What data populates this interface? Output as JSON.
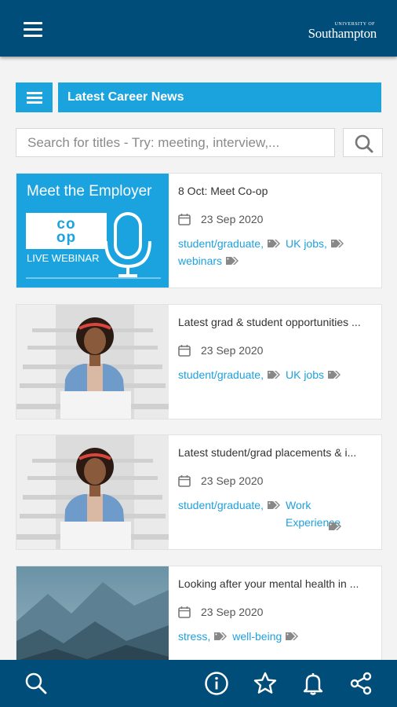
{
  "app": {
    "logo_small": "UNIVERSITY OF",
    "logo_main": "Southampton"
  },
  "section": {
    "title": "Latest Career News"
  },
  "search": {
    "placeholder": "Search for titles - Try: meeting, interview,..."
  },
  "cards": [
    {
      "title": "8 Oct: Meet Co-op",
      "date": "23 Sep 2020",
      "thumb": {
        "heading": "Meet the Employer",
        "logo_top": "co",
        "logo_bottom": "op",
        "caption": "LIVE WEBINAR"
      },
      "tags": [
        "student/graduate,",
        "UK jobs,",
        "webinars"
      ]
    },
    {
      "title": "Latest grad & student opportunities ...",
      "date": "23 Sep 2020",
      "tags": [
        "student/graduate,",
        "UK jobs"
      ]
    },
    {
      "title": "Latest student/grad placements & i...",
      "date": "23 Sep 2020",
      "tags": [
        "student/graduate,",
        "Work Experience"
      ]
    },
    {
      "title": "Looking after your mental health in ...",
      "date": "23 Sep 2020",
      "tags": [
        "stress,",
        "well-being"
      ]
    }
  ],
  "colors": {
    "appbar": "#004d7a",
    "accent": "#1aa3dd",
    "tag_text": "#1ea1dd"
  },
  "bottom_nav": [
    "search-icon",
    "info-icon",
    "star-icon",
    "bell-icon",
    "share-icon"
  ]
}
